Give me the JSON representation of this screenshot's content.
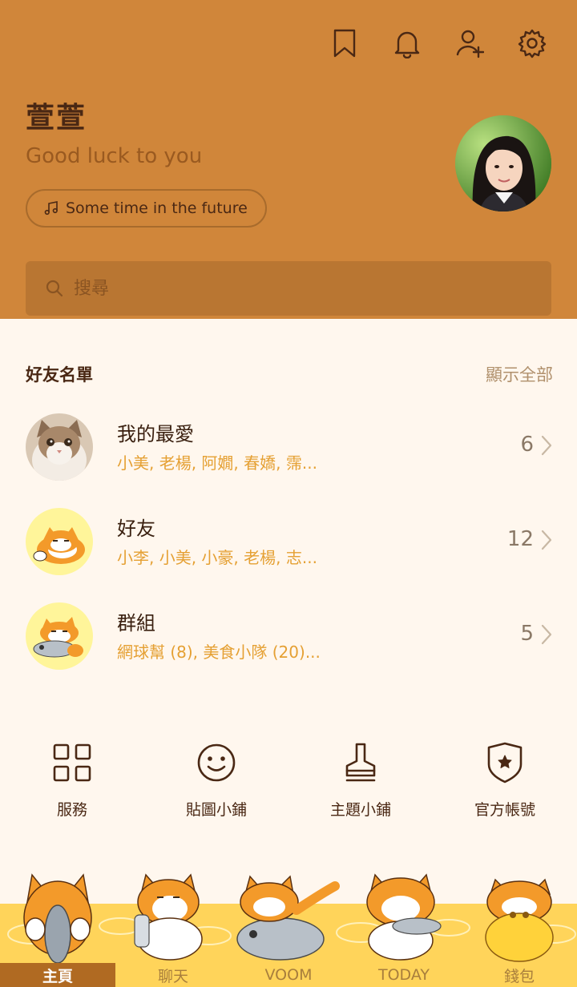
{
  "header": {
    "icons": [
      "bookmark-icon",
      "bell-icon",
      "add-friend-icon",
      "settings-icon"
    ],
    "name": "萱萱",
    "status": "Good luck to you",
    "music": "Some time in the future",
    "search_placeholder": "搜尋"
  },
  "friends": {
    "section_title": "好友名單",
    "show_all": "顯示全部",
    "rows": [
      {
        "title": "我的最愛",
        "sub": "小美, 老楊, 阿嫺, 春嬌, 霈...",
        "count": "6"
      },
      {
        "title": "好友",
        "sub": "小李, 小美, 小豪, 老楊, 志...",
        "count": "12"
      },
      {
        "title": "群組",
        "sub": "網球幫 (8), 美食小隊 (20)...",
        "count": "5"
      }
    ]
  },
  "services": [
    {
      "label": "服務",
      "icon": "grid-icon"
    },
    {
      "label": "貼圖小鋪",
      "icon": "smiley-icon"
    },
    {
      "label": "主題小鋪",
      "icon": "brush-icon"
    },
    {
      "label": "官方帳號",
      "icon": "shield-star-icon"
    }
  ],
  "nav": [
    {
      "label": "主頁",
      "active": true
    },
    {
      "label": "聊天",
      "active": false
    },
    {
      "label": "VOOM",
      "active": false
    },
    {
      "label": "TODAY",
      "active": false
    },
    {
      "label": "錢包",
      "active": false
    }
  ],
  "colors": {
    "header": "#d0863a",
    "background": "#fff7ee",
    "accent_text": "#e5a033",
    "nav_band": "#ffd45a",
    "nav_active": "#b06a22"
  }
}
